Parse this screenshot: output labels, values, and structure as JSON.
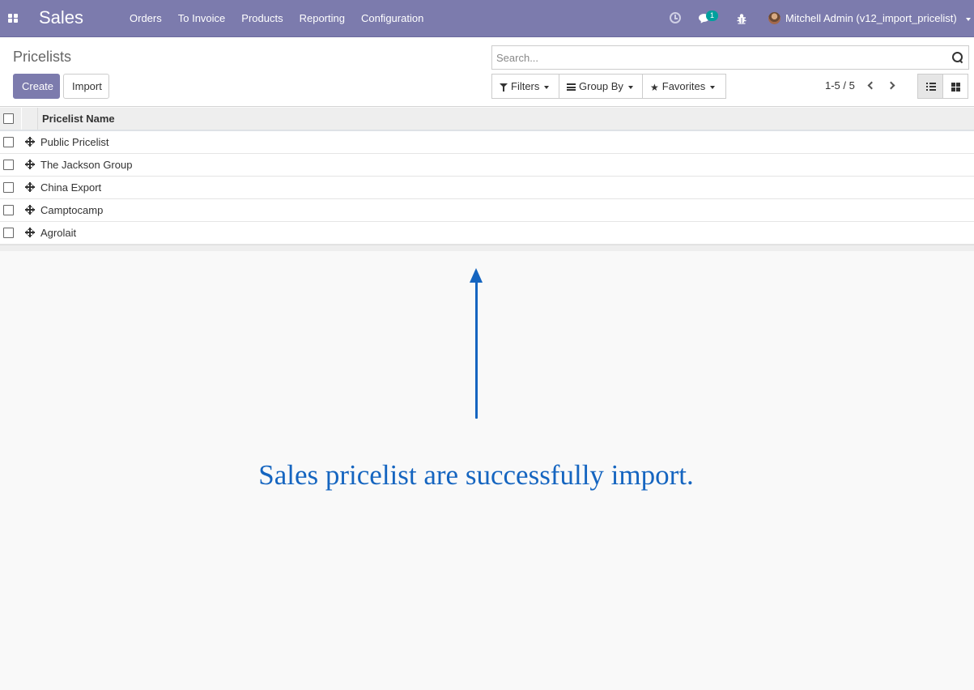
{
  "navbar": {
    "app_title": "Sales",
    "menu": [
      "Orders",
      "To Invoice",
      "Products",
      "Reporting",
      "Configuration"
    ],
    "chat_badge": "1",
    "user": "Mitchell Admin (v12_import_pricelist)",
    "icons": [
      "apps-icon",
      "clock-icon",
      "chat-icon",
      "bug-icon"
    ]
  },
  "control_panel": {
    "breadcrumb": "Pricelists",
    "create_label": "Create",
    "import_label": "Import",
    "search_placeholder": "Search...",
    "filters_label": "Filters",
    "groupby_label": "Group By",
    "favorites_label": "Favorites",
    "pager": "1-5 / 5"
  },
  "list": {
    "column_header": "Pricelist Name",
    "rows": [
      "Public Pricelist",
      "The Jackson Group",
      "China Export",
      "Camptocamp",
      "Agrolait"
    ]
  },
  "annotation": {
    "text": "Sales pricelist are successfully import.",
    "color": "#1565c0"
  },
  "colors": {
    "brand": "#7c7bad",
    "badge": "#00a09d"
  }
}
